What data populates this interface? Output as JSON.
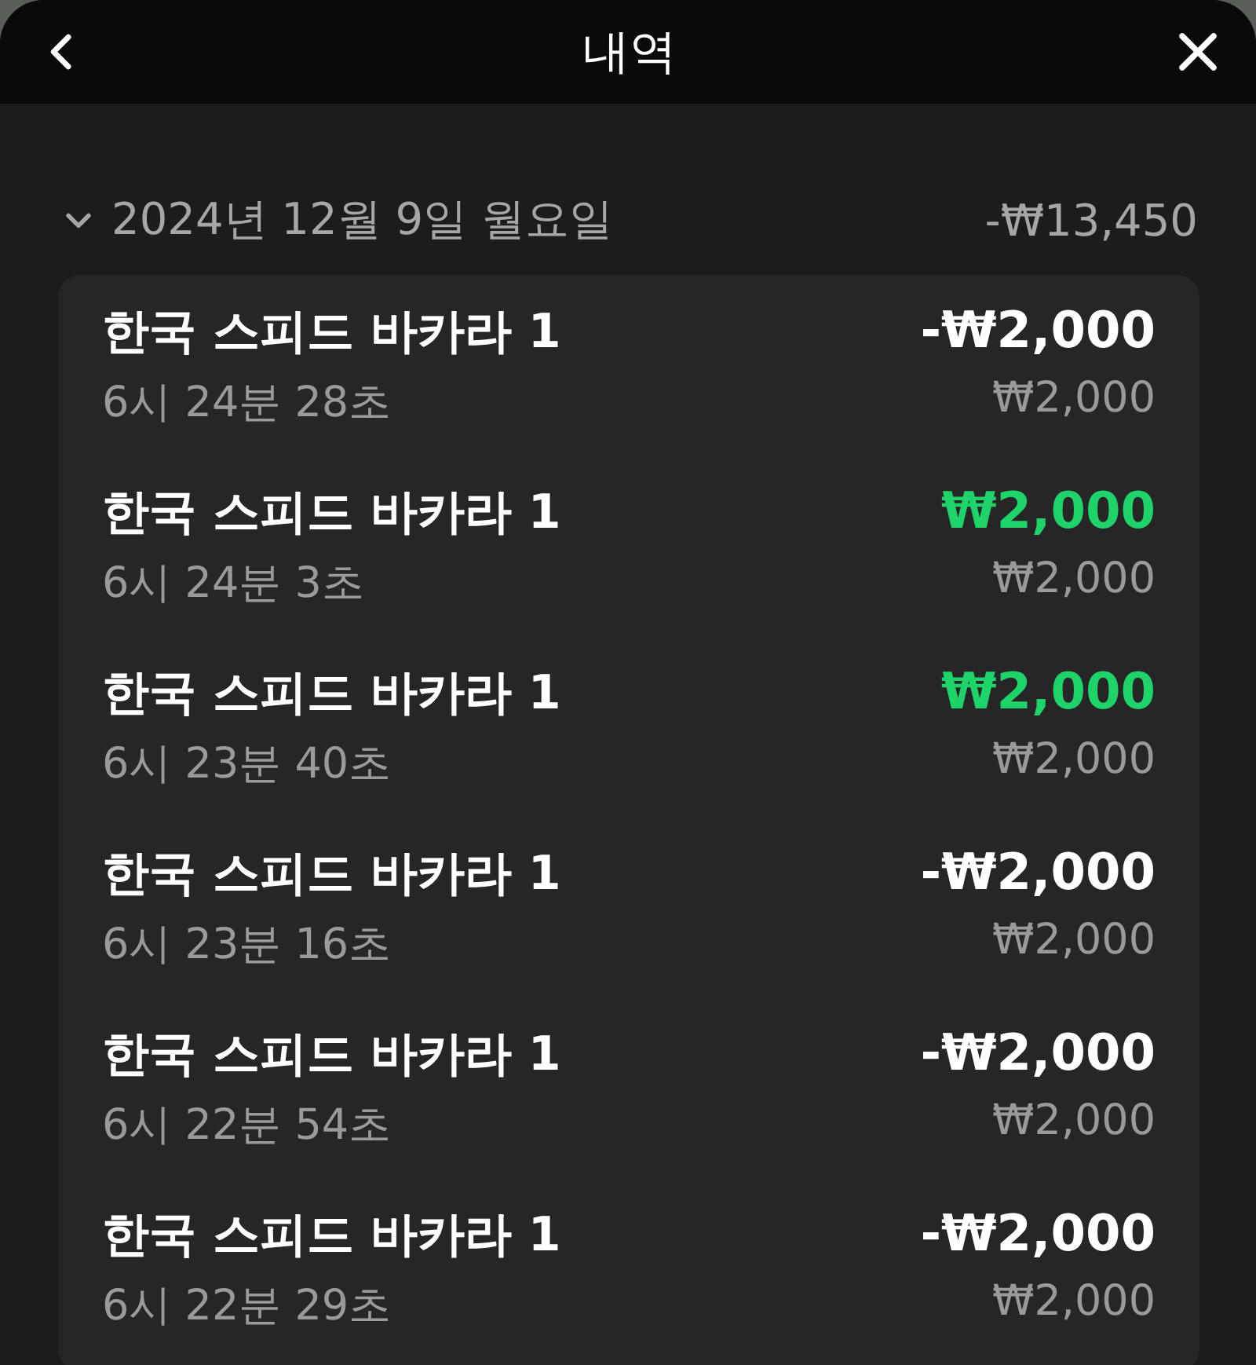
{
  "header": {
    "title": "내역"
  },
  "group": {
    "date": "2024년 12월 9일 월요일",
    "total": "-₩13,450",
    "expanded": true,
    "rows": [
      {
        "game": "한국 스피드 바카라 1",
        "time": "6시 24분 28초",
        "amount": "-₩2,000",
        "stake": "₩2,000",
        "kind": "loss"
      },
      {
        "game": "한국 스피드 바카라 1",
        "time": "6시 24분 3초",
        "amount": "₩2,000",
        "stake": "₩2,000",
        "kind": "win"
      },
      {
        "game": "한국 스피드 바카라 1",
        "time": "6시 23분 40초",
        "amount": "₩2,000",
        "stake": "₩2,000",
        "kind": "win"
      },
      {
        "game": "한국 스피드 바카라 1",
        "time": "6시 23분 16초",
        "amount": "-₩2,000",
        "stake": "₩2,000",
        "kind": "loss"
      },
      {
        "game": "한국 스피드 바카라 1",
        "time": "6시 22분 54초",
        "amount": "-₩2,000",
        "stake": "₩2,000",
        "kind": "loss"
      },
      {
        "game": "한국 스피드 바카라 1",
        "time": "6시 22분 29초",
        "amount": "-₩2,000",
        "stake": "₩2,000",
        "kind": "loss"
      }
    ]
  }
}
